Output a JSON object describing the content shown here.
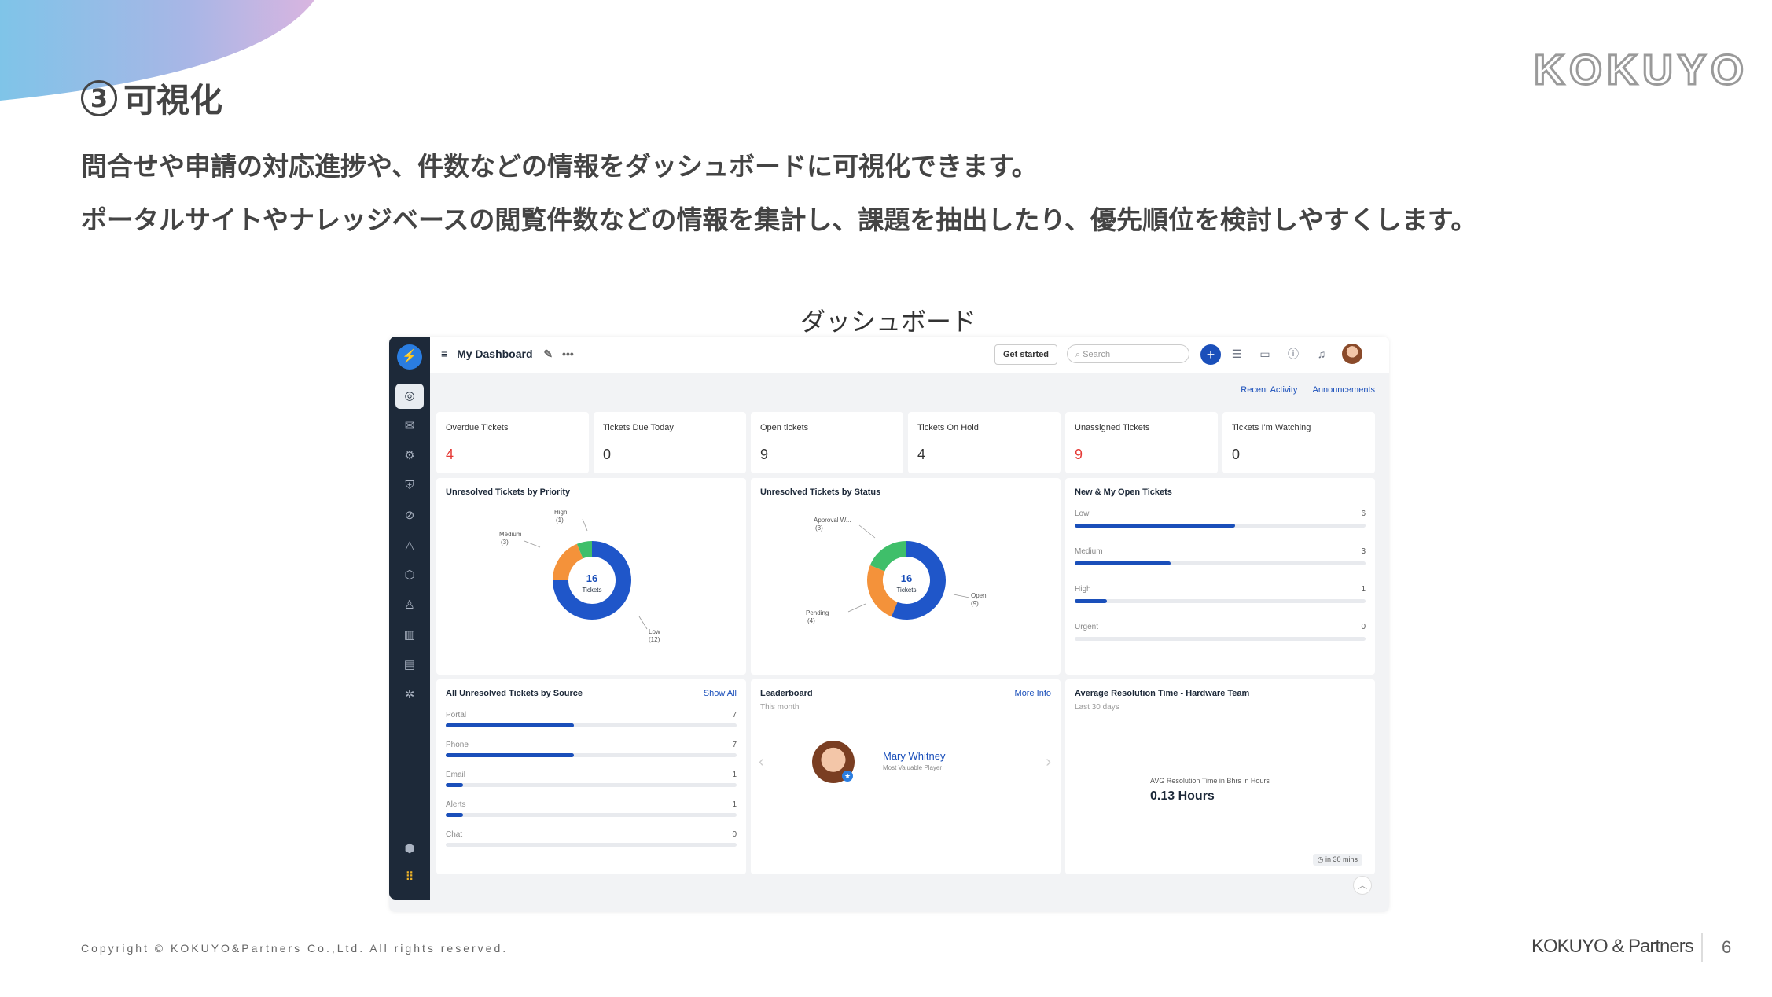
{
  "slide": {
    "section_number": "3",
    "title": "可視化",
    "logo": "KOKUYO",
    "line1": "問合せや申請の対応進捗や、件数などの情報をダッシュボードに可視化できます。",
    "line2": "ポータルサイトやナレッジベースの閲覧件数などの情報を集計し、課題を抽出したり、優先順位を検討しやすくします。",
    "caption": "ダッシュボード",
    "copyright": "Copyright © KOKUYO&Partners Co.,Ltd. All rights reserved.",
    "brand": "KOKUYO & Partners",
    "page": "6"
  },
  "app": {
    "dashboard_title": "My Dashboard",
    "get_started": "Get started",
    "search_placeholder": "Search",
    "sublinks": [
      "Recent Activity",
      "Announcements"
    ],
    "kpis": [
      {
        "label": "Overdue Tickets",
        "value": "4",
        "color": "#e53935"
      },
      {
        "label": "Tickets Due Today",
        "value": "0",
        "color": "#333333"
      },
      {
        "label": "Open tickets",
        "value": "9",
        "color": "#333333"
      },
      {
        "label": "Tickets On Hold",
        "value": "4",
        "color": "#333333"
      },
      {
        "label": "Unassigned Tickets",
        "value": "9",
        "color": "#e53935"
      },
      {
        "label": "Tickets I'm Watching",
        "value": "0",
        "color": "#333333"
      }
    ],
    "priority_chart": {
      "title": "Unresolved Tickets by Priority",
      "center_value": "16",
      "center_label": "Tickets",
      "labels": {
        "high": "High",
        "high_n": "(1)",
        "medium": "Medium",
        "medium_n": "(3)",
        "low": "Low",
        "low_n": "(12)"
      }
    },
    "status_chart": {
      "title": "Unresolved Tickets by Status",
      "center_value": "16",
      "center_label": "Tickets",
      "labels": {
        "approval": "Approval W...",
        "approval_n": "(3)",
        "pending": "Pending",
        "pending_n": "(4)",
        "open": "Open",
        "open_n": "(9)"
      }
    },
    "new_open": {
      "title": "New & My Open Tickets",
      "rows": [
        {
          "label": "Low",
          "value": "6",
          "fraction": 0.55
        },
        {
          "label": "Medium",
          "value": "3",
          "fraction": 0.33
        },
        {
          "label": "High",
          "value": "1",
          "fraction": 0.11
        },
        {
          "label": "Urgent",
          "value": "0",
          "fraction": 0
        }
      ]
    },
    "source": {
      "title": "All Unresolved Tickets by Source",
      "link": "Show All",
      "rows": [
        {
          "label": "Portal",
          "value": "7",
          "fraction": 0.44
        },
        {
          "label": "Phone",
          "value": "7",
          "fraction": 0.44
        },
        {
          "label": "Email",
          "value": "1",
          "fraction": 0.06
        },
        {
          "label": "Alerts",
          "value": "1",
          "fraction": 0.06
        },
        {
          "label": "Chat",
          "value": "0",
          "fraction": 0
        }
      ]
    },
    "leaderboard": {
      "title": "Leaderboard",
      "subtitle": "This month",
      "link": "More Info",
      "name": "Mary Whitney",
      "role": "Most Valuable Player"
    },
    "resolution": {
      "title": "Average Resolution Time - Hardware Team",
      "subtitle": "Last 30 days",
      "metric_label": "AVG Resolution Time in Bhrs in Hours",
      "metric_value": "0.13 Hours",
      "refresh": "in 30 mins"
    }
  },
  "chart_data": [
    {
      "type": "pie",
      "title": "Unresolved Tickets by Priority",
      "categories": [
        "High",
        "Medium",
        "Low"
      ],
      "values": [
        1,
        3,
        12
      ],
      "colors": [
        "#3fbf6a",
        "#f4923a",
        "#1f56c9"
      ]
    },
    {
      "type": "pie",
      "title": "Unresolved Tickets by Status",
      "categories": [
        "Approval W...",
        "Pending",
        "Open"
      ],
      "values": [
        3,
        4,
        9
      ],
      "colors": [
        "#3fbf6a",
        "#f4923a",
        "#1f56c9"
      ]
    }
  ]
}
